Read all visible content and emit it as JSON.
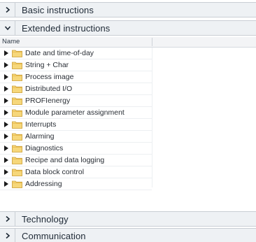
{
  "sections": {
    "basic": {
      "title": "Basic instructions",
      "expanded": false
    },
    "extended": {
      "title": "Extended instructions",
      "expanded": true
    },
    "technology": {
      "title": "Technology",
      "expanded": false
    },
    "communication": {
      "title": "Communication",
      "expanded": false
    }
  },
  "columns": {
    "name": "Name"
  },
  "tree": {
    "items": [
      {
        "label": "Date and time-of-day"
      },
      {
        "label": "String + Char"
      },
      {
        "label": "Process image"
      },
      {
        "label": "Distributed I/O"
      },
      {
        "label": "PROFIenergy"
      },
      {
        "label": "Module parameter assignment"
      },
      {
        "label": "Interrupts"
      },
      {
        "label": "Alarming"
      },
      {
        "label": "Diagnostics"
      },
      {
        "label": "Recipe and data logging"
      },
      {
        "label": "Data block control"
      },
      {
        "label": "Addressing"
      }
    ]
  },
  "icons": {
    "collapsed": "chevron-right-icon",
    "expanded": "chevron-down-icon",
    "tree_arrow": "triangle-right-icon",
    "folder": "folder-icon"
  },
  "colors": {
    "header_bg": "#eef1f4",
    "folder_fill": "#f6d77a",
    "folder_stroke": "#c99a2e"
  }
}
